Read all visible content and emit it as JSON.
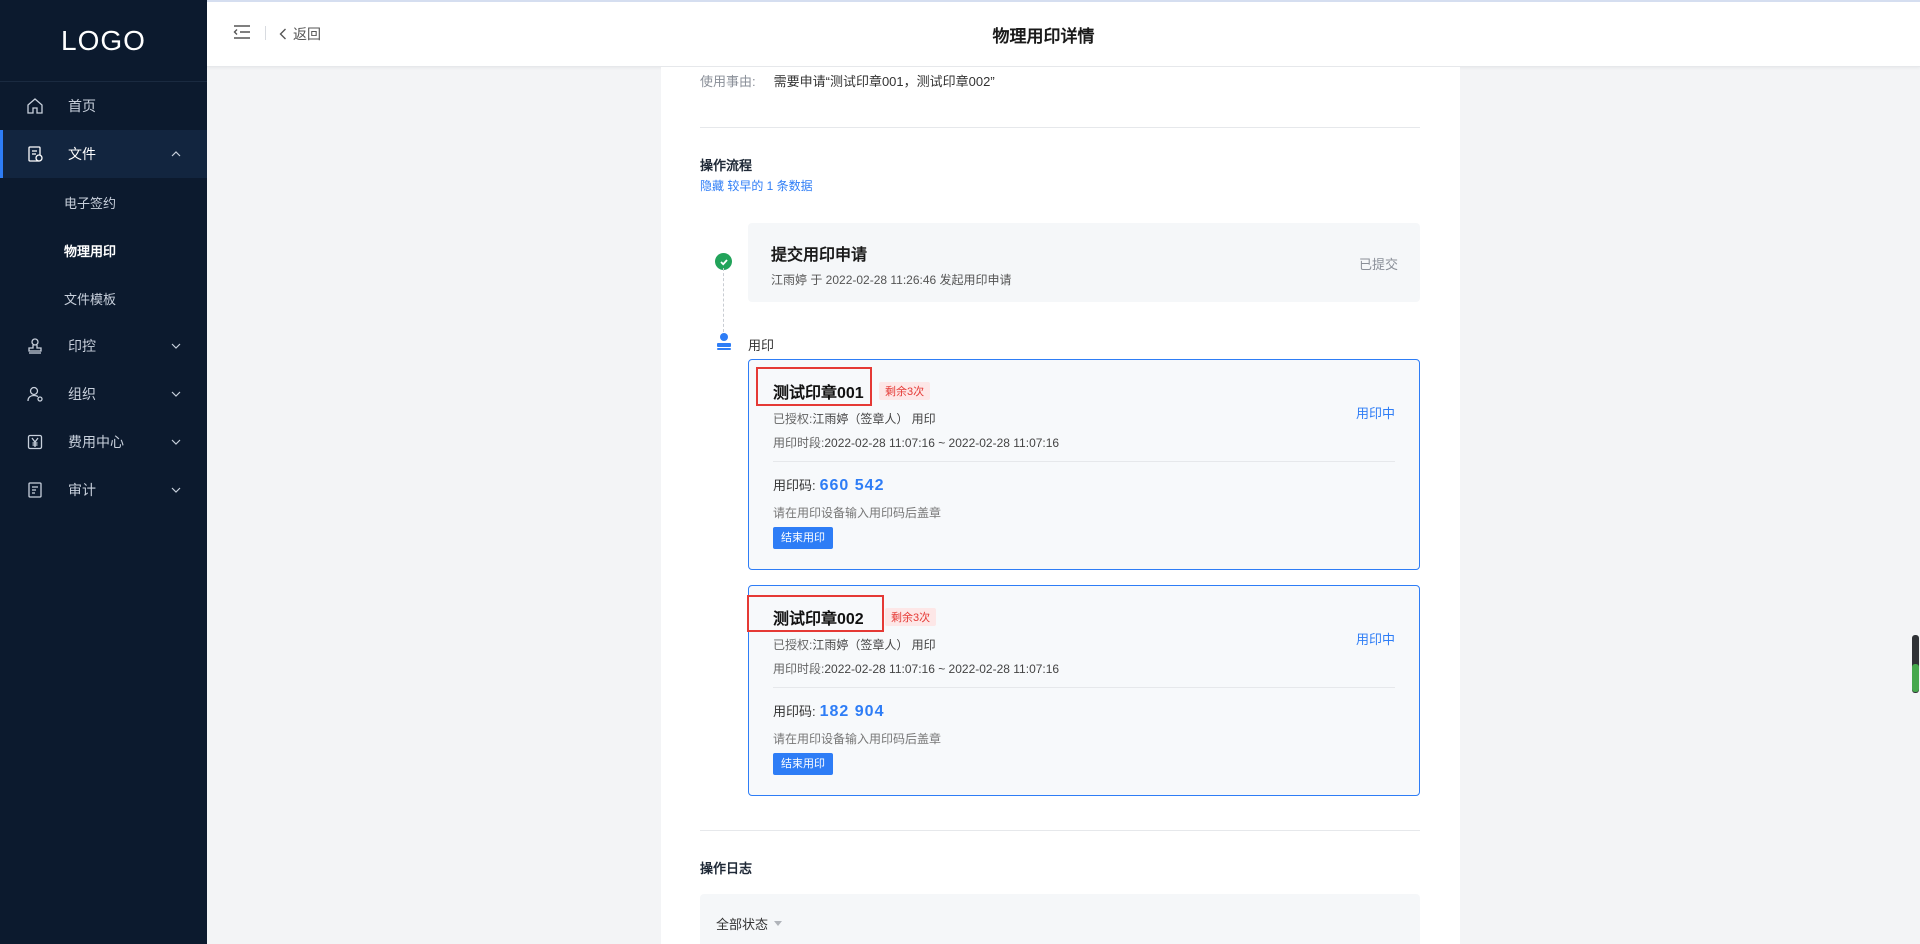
{
  "sidebar": {
    "logo": "LOGO",
    "items": [
      {
        "label": "首页",
        "icon": "home-icon"
      },
      {
        "label": "文件",
        "icon": "file-icon",
        "expanded": true
      },
      {
        "label": "印控",
        "icon": "stamp-icon"
      },
      {
        "label": "组织",
        "icon": "organization-icon"
      },
      {
        "label": "费用中心",
        "icon": "yen-icon"
      },
      {
        "label": "审计",
        "icon": "audit-icon"
      }
    ],
    "sub_items": [
      {
        "label": "电子签约"
      },
      {
        "label": "物理用印",
        "current": true
      },
      {
        "label": "文件模板"
      }
    ]
  },
  "header": {
    "back_label": "返回",
    "title": "物理用印详情"
  },
  "content": {
    "reason_label": "使用事由:",
    "reason_value": "需要申请“测试印章001，测试印章002”",
    "process_title": "操作流程",
    "hide_link": "隐藏 较早的 1 条数据",
    "submit": {
      "title": "提交用印申请",
      "subtitle": "江雨婷  于 2022-02-28 11:26:46 发起用印申请",
      "status": "已提交"
    },
    "use_label": "用印",
    "seals": [
      {
        "name": "测试印章001",
        "remaining": "剩余3次",
        "auth_label": "已授权:",
        "auth_value": "江雨婷（签章人） 用印",
        "period_label": "用印时段:",
        "period_value": "2022-02-28 11:07:16 ~ 2022-02-28 11:07:16",
        "status": "用印中",
        "code_label": "用印码:",
        "code": "660  542",
        "hint": "请在用印设备输入用印码后盖章",
        "button": "结束用印"
      },
      {
        "name": "测试印章002",
        "remaining": "剩余3次",
        "auth_label": "已授权:",
        "auth_value": "江雨婷（签章人） 用印",
        "period_label": "用印时段:",
        "period_value": "2022-02-28 11:07:16 ~ 2022-02-28 11:07:16",
        "status": "用印中",
        "code_label": "用印码:",
        "code": "182  904",
        "hint": "请在用印设备输入用印码后盖章",
        "button": "结束用印"
      }
    ],
    "log_title": "操作日志",
    "log_filter": "全部状态"
  },
  "colors": {
    "sidebar_bg": "#0c1a2e",
    "accent": "#2e7df6",
    "success": "#22a35a",
    "danger": "#e53935"
  }
}
